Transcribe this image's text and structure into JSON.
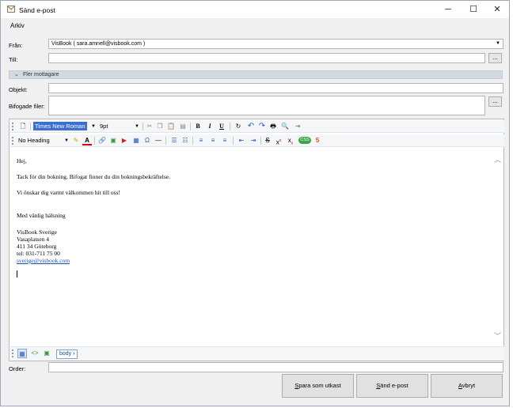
{
  "window": {
    "title": "Sänd e-post",
    "minimize": "─",
    "maximize": "☐",
    "close": "✕"
  },
  "menu": {
    "items": [
      "Arkiv"
    ]
  },
  "form": {
    "from_label": "Från:",
    "from_value": "VisBook ( sara.amnell@visbook.com )",
    "to_label": "Till:",
    "to_value": "",
    "more_recipients": "Fler mottagare",
    "subject_label": "Objekt:",
    "subject_value": "",
    "attachments_label": "Bifogade filer:",
    "ellipsis": "...",
    "order_label": "Order:",
    "order_value": ""
  },
  "editor": {
    "font_name": "Times New Roman",
    "font_size": "9pt",
    "paragraph_style": "No Heading",
    "breadcrumb": "body",
    "body_lines": [
      "Hej,",
      "Tack för din bokning. Bifogat finner du din bokningsbekräftelse.",
      "Vi önskar dig varmt välkommen hit till oss!",
      "Med vänlig hälsning",
      "VisBook Sverige",
      "Vasaplatsen 4",
      "411 34 Göteborg",
      "tel: 031-711 75 00",
      "sverige@visbook.com"
    ]
  },
  "buttons": {
    "save_draft_mnemonic": "S",
    "save_draft_rest": "para som utkast",
    "send_mnemonic": "S",
    "send_rest": "änd e-post",
    "cancel_mnemonic": "A",
    "cancel_rest": "vbryt"
  },
  "icons": {
    "app": "envelope-icon",
    "dropdown": "chevron-down-icon",
    "collapse": "chevron-up-icon"
  },
  "colors": {
    "accent": "#1a4fc9",
    "selection": "#3b6fd1",
    "window_border": "#9aa7b8"
  }
}
